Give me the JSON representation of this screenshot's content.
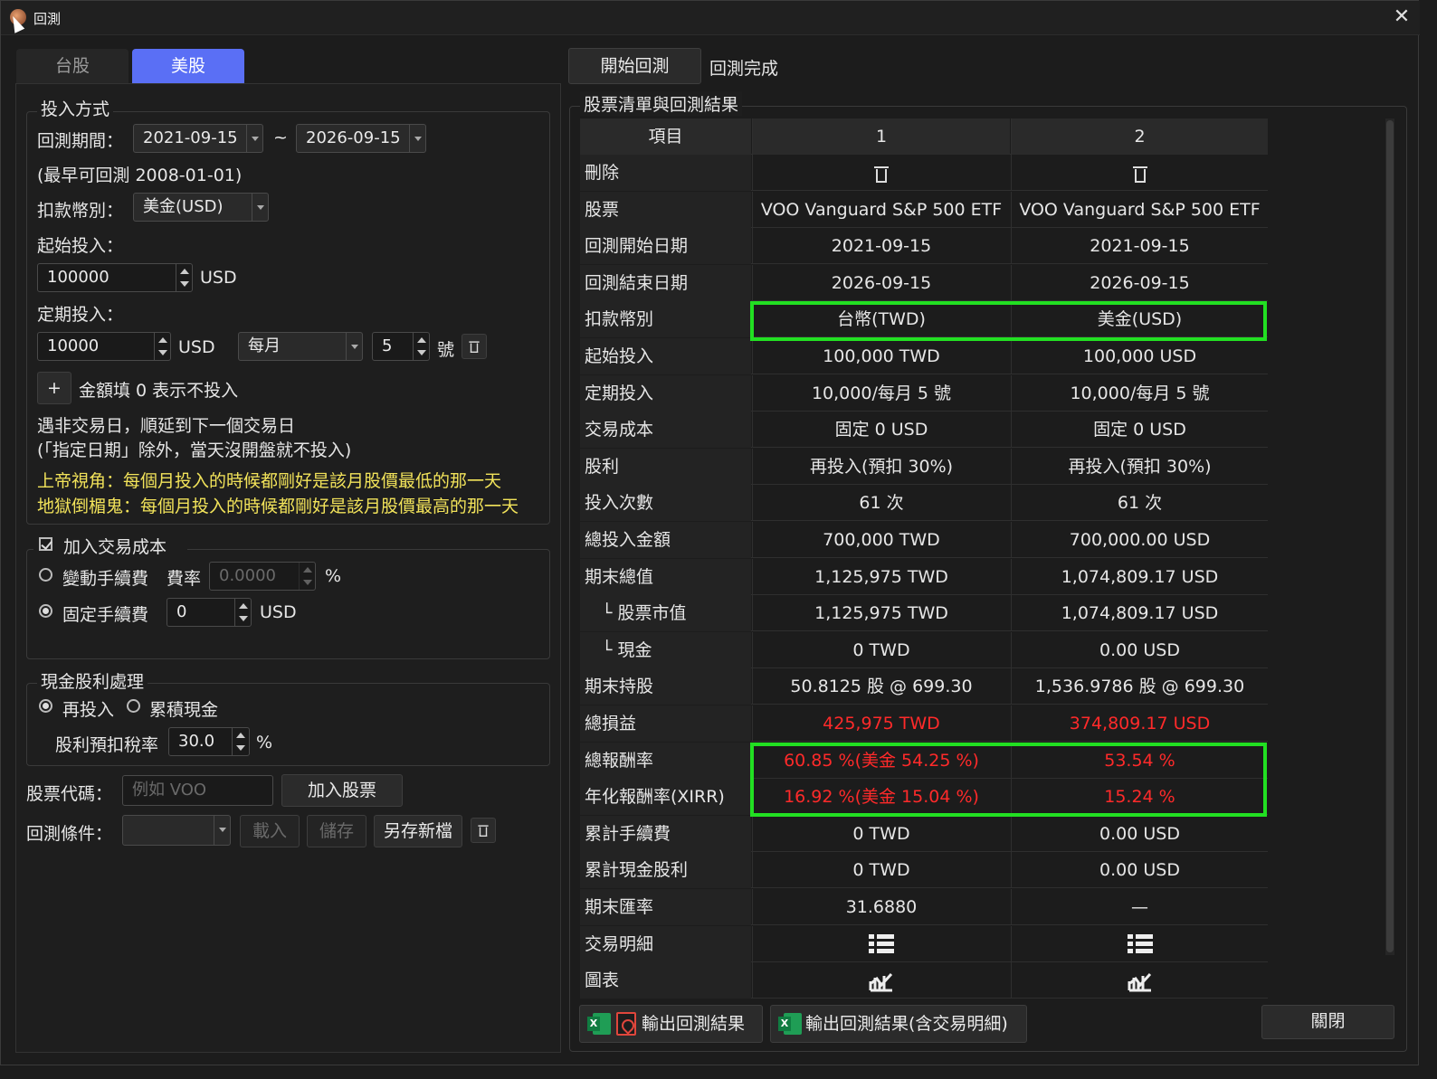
{
  "window": {
    "title": "回測",
    "close_glyph": "✕"
  },
  "tabs": [
    "台股",
    "美股"
  ],
  "left": {
    "invest_group_title": "投入方式",
    "period_label": "回測期間：",
    "start_date": "2021-09-15",
    "tilde": "~",
    "end_date": "2026-09-15",
    "earliest_note": "(最早可回測 2008-01-01)",
    "currency_label": "扣款幣別：",
    "currency_value": "美金(USD)",
    "initial_label": "起始投入：",
    "initial_value": "100000",
    "initial_unit": "USD",
    "periodic_label": "定期投入：",
    "periodic_value": "10000",
    "periodic_unit": "USD",
    "frequency": "每月",
    "day_value": "5",
    "day_unit": "號",
    "add_glyph": "+",
    "zero_note": "金額填 0 表示不投入",
    "non_trading_note1": "遇非交易日，順延到下一個交易日",
    "non_trading_note2": "(「指定日期」除外，當天沒開盤就不投入)",
    "god_view": "上帝視角：每個月投入的時候都剛好是該月股價最低的那一天",
    "bad_luck": "地獄倒楣鬼：每個月投入的時候都剛好是該月股價最高的那一天",
    "cost_group_title": "加入交易成本",
    "variable_fee_label": "變動手續費",
    "rate_label": "費率",
    "rate_value": "0.0000",
    "rate_unit": "%",
    "fixed_fee_label": "固定手續費",
    "fixed_fee_value": "0",
    "fixed_fee_unit": "USD",
    "dividend_group_title": "現金股利處理",
    "reinvest_label": "再投入",
    "accumulate_label": "累積現金",
    "tax_label": "股利預扣稅率",
    "tax_value": "30.0",
    "tax_unit": "%",
    "ticker_label": "股票代碼：",
    "ticker_placeholder": "例如 VOO",
    "add_stock_button": "加入股票",
    "condition_label": "回測條件：",
    "load_button": "載入",
    "save_button": "儲存",
    "save_as_button": "另存新檔"
  },
  "right": {
    "start_button": "開始回測",
    "status": "回測完成",
    "group_title": "股票清單與回測結果",
    "export_button": "輸出回測結果",
    "export_detail_button": "輸出回測結果(含交易明細)",
    "close_button": "關閉"
  },
  "table": {
    "headers": [
      "項目",
      "1",
      "2"
    ],
    "rows": [
      {
        "label": "刪除",
        "v1": "",
        "v2": ""
      },
      {
        "label": "股票",
        "v1": "VOO Vanguard S&P 500 ETF",
        "v2": "VOO Vanguard S&P 500 ETF"
      },
      {
        "label": "回測開始日期",
        "v1": "2021-09-15",
        "v2": "2021-09-15"
      },
      {
        "label": "回測結束日期",
        "v1": "2026-09-15",
        "v2": "2026-09-15"
      },
      {
        "label": "扣款幣別",
        "v1": "台幣(TWD)",
        "v2": "美金(USD)"
      },
      {
        "label": "起始投入",
        "v1": "100,000 TWD",
        "v2": "100,000 USD"
      },
      {
        "label": "定期投入",
        "v1": "10,000/每月 5 號",
        "v2": "10,000/每月 5 號"
      },
      {
        "label": "交易成本",
        "v1": "固定 0 USD",
        "v2": "固定 0 USD"
      },
      {
        "label": "股利",
        "v1": "再投入(預扣 30%)",
        "v2": "再投入(預扣 30%)"
      },
      {
        "label": "投入次數",
        "v1": "61 次",
        "v2": "61 次"
      },
      {
        "label": "總投入金額",
        "v1": "700,000 TWD",
        "v2": "700,000.00 USD"
      },
      {
        "label": "期末總值",
        "v1": "1,125,975 TWD",
        "v2": "1,074,809.17 USD"
      },
      {
        "label": "└ 股票市值",
        "v1": "1,125,975 TWD",
        "v2": "1,074,809.17 USD"
      },
      {
        "label": "└ 現金",
        "v1": "0 TWD",
        "v2": "0.00 USD"
      },
      {
        "label": "期末持股",
        "v1": "50.8125 股 @ 699.30",
        "v2": "1,536.9786 股 @ 699.30"
      },
      {
        "label": "總損益",
        "v1": "425,975 TWD",
        "v2": "374,809.17 USD"
      },
      {
        "label": "總報酬率",
        "v1": "60.85 %(美金 54.25 %)",
        "v2": "53.54 %"
      },
      {
        "label": "年化報酬率(XIRR)",
        "v1": "16.92 %(美金 15.04 %)",
        "v2": "15.24 %"
      },
      {
        "label": "累計手續費",
        "v1": "0 TWD",
        "v2": "0.00 USD"
      },
      {
        "label": "累計現金股利",
        "v1": "0 TWD",
        "v2": "0.00 USD"
      },
      {
        "label": "期末匯率",
        "v1": "31.6880",
        "v2": "—"
      },
      {
        "label": "交易明細",
        "v1": "",
        "v2": ""
      },
      {
        "label": "圖表",
        "v1": "",
        "v2": ""
      }
    ]
  },
  "colors": {
    "accent": "#5a6ff5",
    "highlight": "#22e022",
    "negative": "#ff2a2a",
    "warning_text": "#f2e35a"
  },
  "icons": [
    "trash-icon",
    "list-icon",
    "chart-icon",
    "excel-icon",
    "pdf-icon"
  ]
}
